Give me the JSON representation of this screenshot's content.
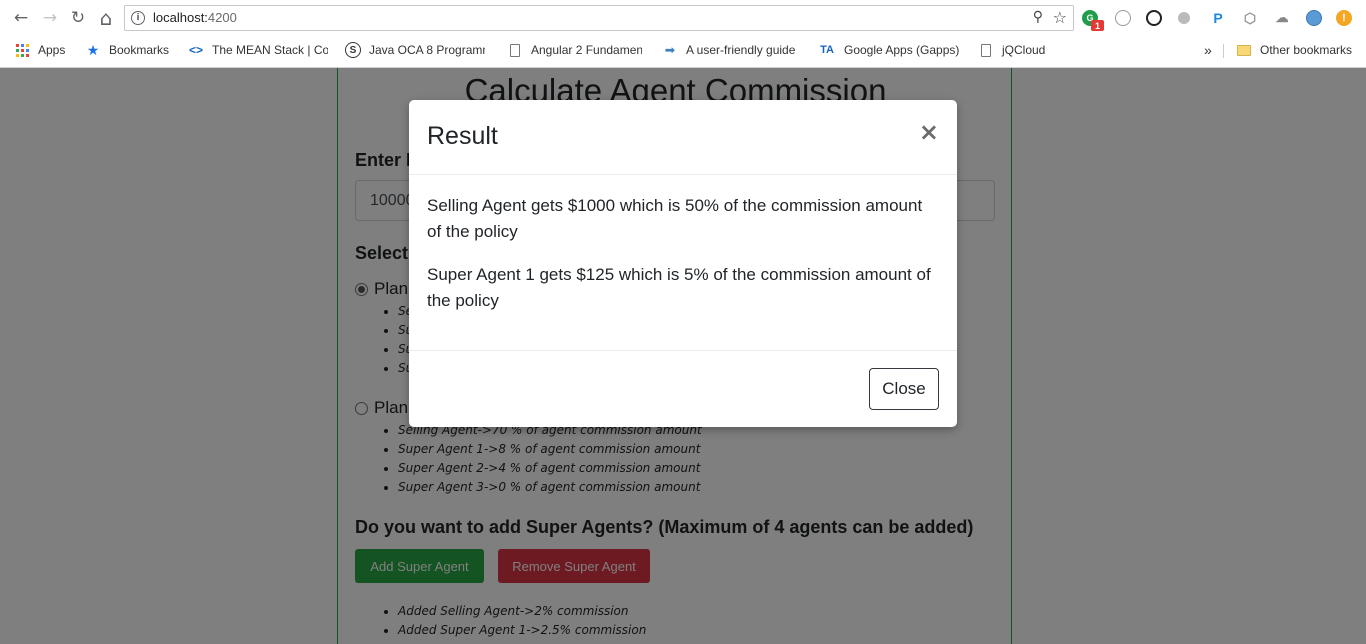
{
  "browser": {
    "url_host": "localhost:",
    "url_port": "4200",
    "nav_icons": {
      "back": "←",
      "forward": "→",
      "reload": "↻",
      "home": "⌂"
    },
    "extension_badge": "1",
    "bookmarks": [
      {
        "label": "Apps",
        "icon": "apps-grid"
      },
      {
        "label": "Bookmarks",
        "icon": "star"
      },
      {
        "label": "The MEAN Stack | Co",
        "icon": "code"
      },
      {
        "label": "Java OCA 8 Programm",
        "icon": "s-logo"
      },
      {
        "label": "Angular 2 Fundamen",
        "icon": "file"
      },
      {
        "label": "A user-friendly guide",
        "icon": "arrow"
      },
      {
        "label": "Google Apps (Gapps)",
        "icon": "ta-logo"
      },
      {
        "label": "jQCloud",
        "icon": "file"
      }
    ],
    "overflow_label": "»",
    "other_bookmarks": "Other bookmarks"
  },
  "page": {
    "title": "Calculate Agent Commission",
    "enter_label": "Enter F",
    "amount_value": "10000",
    "select_label": "Select",
    "plan_label_1": "Plan",
    "plan_label_2": "Plan",
    "plan1_items": [
      "Se",
      "Su",
      "Su",
      "Su"
    ],
    "plan2_items": [
      "Selling Agent->70 % of agent commission amount",
      "Super Agent 1->8 % of agent commission amount",
      "Super Agent 2->4 % of agent commission amount",
      "Super Agent 3->0 % of agent commission amount"
    ],
    "super_agents_question": "Do you want to add Super Agents? (Maximum of 4 agents can be added)",
    "add_button": "Add Super Agent",
    "remove_button": "Remove Super Agent",
    "added_items": [
      "Added Selling Agent->2% commission",
      "Added Super Agent 1->2.5% commission"
    ]
  },
  "modal": {
    "title": "Result",
    "close_x": "×",
    "lines": [
      "Selling Agent gets $1000 which is 50% of the commission amount of the policy",
      "Super Agent 1 gets $125 which is 5% of the commission amount of the policy"
    ],
    "close_button": "Close"
  }
}
